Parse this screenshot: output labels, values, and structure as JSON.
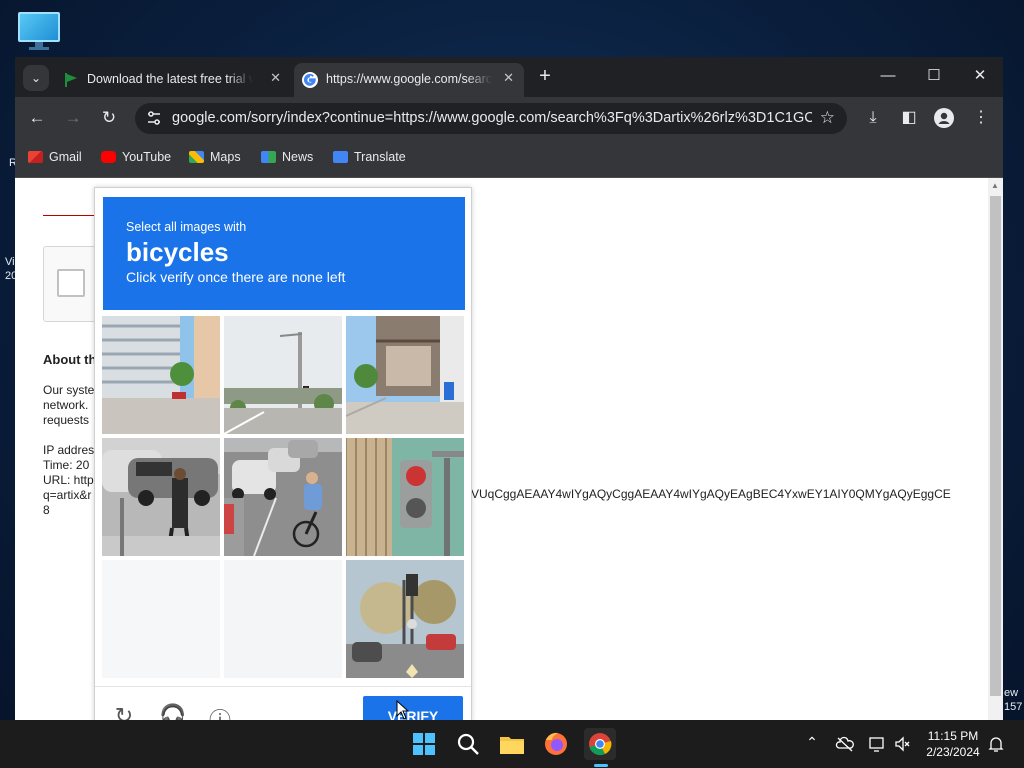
{
  "desktop": {
    "left_edge_text": [
      "R",
      "Vi",
      "20"
    ],
    "right_edge_text": [
      "ew",
      "157"
    ]
  },
  "browser": {
    "tabs": [
      {
        "title": "Download the latest free trial v",
        "active": false
      },
      {
        "title": "https://www.google.com/search",
        "active": true
      }
    ],
    "new_tab": "+",
    "window_controls": {
      "minimize": "—",
      "maximize": "☐",
      "close": "✕"
    },
    "nav": {
      "back": "←",
      "forward": "→",
      "reload": "↻"
    },
    "address": "google.com/sorry/index?continue=https://www.google.com/search%3Fq%3Dartix%26rlz%3D1C1GCE...",
    "bookmarks": [
      "Gmail",
      "YouTube",
      "Maps",
      "News",
      "Translate"
    ]
  },
  "page": {
    "about_heading": "About th",
    "body_lines": [
      "Our syste",
      "network.",
      "requests"
    ],
    "ip_lines": [
      "IP addres",
      "Time: 20",
      "URL: http",
      "q=artix&r",
      "8"
    ],
    "url_tail": "VUqCggAEAAY4wIYgAQyCggAEAAY4wIYgAQyEAgBEC4YxwEY1AIY0QMYgAQyEggCE"
  },
  "captcha": {
    "instruction": "Select all images with",
    "target": "bicycles",
    "sub_instruction": "Click verify once there are none left",
    "verify_label": "VERIFY",
    "colors": {
      "header": "#1a73e8",
      "button": "#1a73e8"
    }
  },
  "taskbar": {
    "time": "11:15 PM",
    "date": "2/23/2024"
  }
}
